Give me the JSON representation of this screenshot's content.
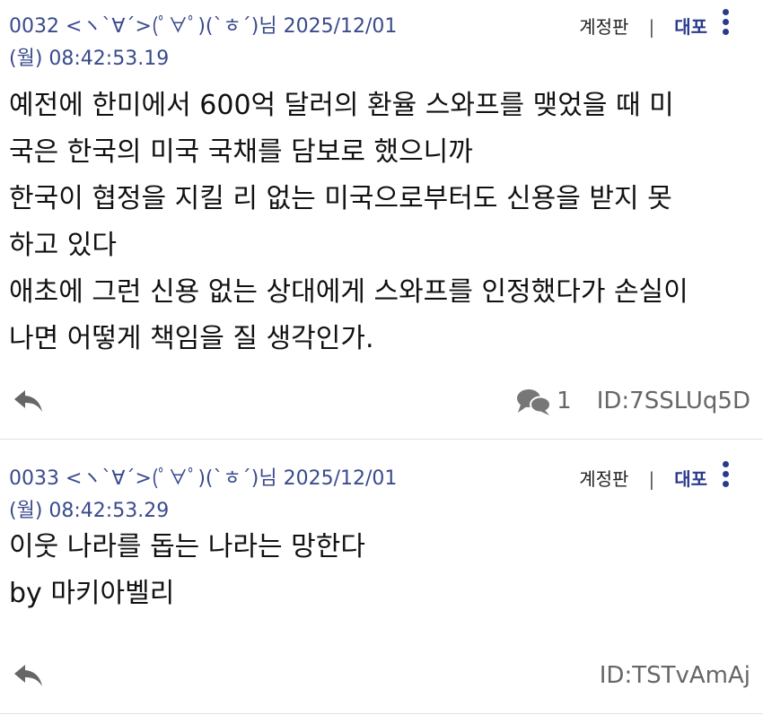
{
  "posts": [
    {
      "number": "0032",
      "nickname": "<ヽ`∀´>(ﾟ∀ﾟ)(`ㅎ´)님",
      "date": "2025/12/01",
      "day_time": "(월) 08:42:53.19",
      "account_label": "계정판",
      "dapo_label": "대포",
      "body_lines": [
        "예전에 한미에서 600억 달러의 환율 스와프를 맺었을 때 미",
        "국은 한국의 미국 국채를 담보로 했으니까",
        "한국이 협정을 지킬 리 없는 미국으로부터도 신용을 받지 못",
        "하고 있다",
        "애초에 그런 신용 없는 상대에게 스와프를 인정했다가 손실이",
        "나면 어떻게 책임을 질 생각인가."
      ],
      "comment_count": "1",
      "user_id": "ID:7SSLUq5D"
    },
    {
      "number": "0033",
      "nickname": "<ヽ`∀´>(ﾟ∀ﾟ)(`ㅎ´)님",
      "date": "2025/12/01",
      "day_time": "(월) 08:42:53.29",
      "account_label": "계정판",
      "dapo_label": "대포",
      "body_lines": [
        "이웃 나라를 돕는 나라는 망한다",
        "by 마키아벨리"
      ],
      "user_id": "ID:TSTvAmAj"
    }
  ],
  "icons": {
    "reply": "reply-arrow-icon",
    "comments": "comments-bubble-icon",
    "more": "kebab-menu-icon"
  },
  "colors": {
    "meta_text": "#3a4a8c",
    "accent": "#2a3a8c",
    "muted": "#666666",
    "divider": "#e2e2e2"
  }
}
